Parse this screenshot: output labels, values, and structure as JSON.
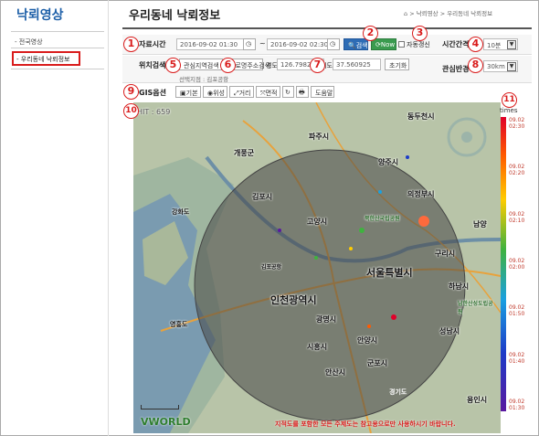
{
  "sidebar": {
    "title": "낙뢰영상",
    "items": [
      {
        "label": "- 전국영상"
      },
      {
        "label": "- 우리동네 낙뢰정보"
      }
    ]
  },
  "header": {
    "title": "우리동네 낙뢰정보",
    "breadcrumb": "⌂ > 낙뢰영상 > 우리동네 낙뢰정보"
  },
  "form": {
    "period_label": "자료시간",
    "start_time": "2016-09-02 01:30",
    "tilde": "~",
    "end_time": "2016-09-02 02:30",
    "search_btn": "검색",
    "now_btn": "Now",
    "auto_refresh_label": "자동갱신",
    "interval_label": "시간간격",
    "interval_value": "10분",
    "location_label": "위치검색",
    "region_tab": "관심지역검색",
    "address_tab": "도로명주소검색",
    "lon_label": "경도",
    "lon_value": "126.79825",
    "lat_label": "위도",
    "lat_value": "37.560925",
    "reset_btn": "초기화",
    "selected_place": "선택지점 : 김포공항",
    "radius_label": "관심반경",
    "radius_value": "30km",
    "gis_label": "GIS옵션",
    "gis_buttons": [
      "기본",
      "위성",
      "거리",
      "면적",
      "↻",
      "🖶",
      "도움말"
    ]
  },
  "map": {
    "hit_label": "HIT : 659",
    "places": [
      "동두천시",
      "파주시",
      "양주시",
      "개풍군",
      "의정부시",
      "김포시",
      "고양시",
      "북한산국립공원",
      "남양",
      "구리시",
      "강화도",
      "김포공항",
      "서울특별시",
      "하남시",
      "인천광역시",
      "광명시",
      "성남시",
      "시흥시",
      "안양시",
      "군포시",
      "안산시",
      "용인시",
      "영흥도",
      "남한산성도립공원",
      "경기도"
    ],
    "vworld": "VWORLD",
    "disclaimer": "지적도를 포함한 모든 주제도는 참고용으로만 사용하시기 바랍니다."
  },
  "legend": {
    "unit": "times",
    "ticks": [
      "09.02\n02:30",
      "09.02\n02:20",
      "09.02\n02:10",
      "09.02\n02:00",
      "09.02\n01:50",
      "09.02\n01:40",
      "09.02\n01:30"
    ]
  },
  "markers": [
    "1",
    "2",
    "3",
    "4",
    "5",
    "6",
    "7",
    "8",
    "9",
    "10",
    "11"
  ]
}
